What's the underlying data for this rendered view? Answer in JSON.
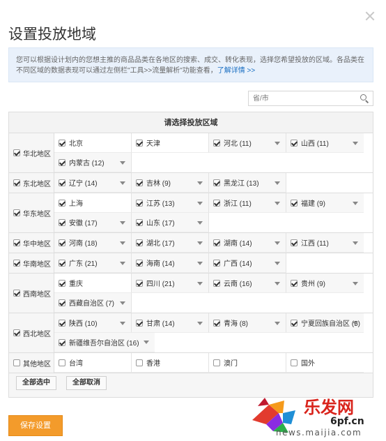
{
  "dialog": {
    "title": "设置投放地域",
    "notice_text": "您可以根据设计划内的您想主推的商品品类在各地区的搜索、成交、转化表现，选择您希望投放的区域。各品类在不同区域的数据表现可以通过左侧栏\"工具>>流量解析\"功能查看，",
    "notice_link": "了解详情",
    "notice_tail": " >>",
    "search_placeholder": "省/市",
    "table_header": "请选择投放区域",
    "select_all": "全部选中",
    "deselect_all": "全部取消",
    "save": "保存设置"
  },
  "regions": [
    {
      "name": "华北地区",
      "checked": true,
      "provinces": [
        {
          "label": "北京",
          "checked": true,
          "expandable": false
        },
        {
          "label": "天津",
          "checked": true,
          "expandable": false
        },
        {
          "label": "河北 (11)",
          "checked": true,
          "expandable": true
        },
        {
          "label": "山西 (11)",
          "checked": true,
          "expandable": true
        },
        {
          "label": "内蒙古 (12)",
          "checked": true,
          "expandable": true
        }
      ]
    },
    {
      "name": "东北地区",
      "checked": true,
      "provinces": [
        {
          "label": "辽宁 (14)",
          "checked": true,
          "expandable": true
        },
        {
          "label": "吉林 (9)",
          "checked": true,
          "expandable": true
        },
        {
          "label": "黑龙江 (13)",
          "checked": true,
          "expandable": true
        }
      ]
    },
    {
      "name": "华东地区",
      "checked": true,
      "provinces": [
        {
          "label": "上海",
          "checked": true,
          "expandable": false
        },
        {
          "label": "江苏 (13)",
          "checked": true,
          "expandable": true
        },
        {
          "label": "浙江 (11)",
          "checked": true,
          "expandable": true
        },
        {
          "label": "福建 (9)",
          "checked": true,
          "expandable": true
        },
        {
          "label": "安徽 (17)",
          "checked": true,
          "expandable": true
        },
        {
          "label": "山东 (17)",
          "checked": true,
          "expandable": true
        }
      ]
    },
    {
      "name": "华中地区",
      "checked": true,
      "provinces": [
        {
          "label": "河南 (18)",
          "checked": true,
          "expandable": true
        },
        {
          "label": "湖北 (17)",
          "checked": true,
          "expandable": true
        },
        {
          "label": "湖南 (14)",
          "checked": true,
          "expandable": true
        },
        {
          "label": "江西 (11)",
          "checked": true,
          "expandable": true
        }
      ]
    },
    {
      "name": "华南地区",
      "checked": true,
      "provinces": [
        {
          "label": "广东 (21)",
          "checked": true,
          "expandable": true
        },
        {
          "label": "海南 (14)",
          "checked": true,
          "expandable": true
        },
        {
          "label": "广西 (14)",
          "checked": true,
          "expandable": true
        }
      ]
    },
    {
      "name": "西南地区",
      "checked": true,
      "provinces": [
        {
          "label": "重庆",
          "checked": true,
          "expandable": false
        },
        {
          "label": "四川 (21)",
          "checked": true,
          "expandable": true
        },
        {
          "label": "云南 (16)",
          "checked": true,
          "expandable": true
        },
        {
          "label": "贵州 (9)",
          "checked": true,
          "expandable": true
        },
        {
          "label": "西藏自治区 (7)",
          "checked": true,
          "expandable": true
        }
      ]
    },
    {
      "name": "西北地区",
      "checked": true,
      "provinces": [
        {
          "label": "陕西 (10)",
          "checked": true,
          "expandable": true
        },
        {
          "label": "甘肃 (14)",
          "checked": true,
          "expandable": true
        },
        {
          "label": "青海 (8)",
          "checked": true,
          "expandable": true
        },
        {
          "label": "宁夏回族自治区 (5)",
          "checked": true,
          "expandable": true
        },
        {
          "label": "新疆维吾尔自治区 (16)",
          "checked": true,
          "expandable": true
        }
      ]
    },
    {
      "name": "其他地区",
      "checked": false,
      "provinces": [
        {
          "label": "台湾",
          "checked": false,
          "expandable": false
        },
        {
          "label": "香港",
          "checked": false,
          "expandable": false
        },
        {
          "label": "澳门",
          "checked": false,
          "expandable": false
        },
        {
          "label": "国外",
          "checked": false,
          "expandable": false
        }
      ]
    }
  ],
  "watermark": {
    "brand": "乐发网",
    "domain_big": "6pf.cn",
    "url": "news.maijia.com"
  }
}
